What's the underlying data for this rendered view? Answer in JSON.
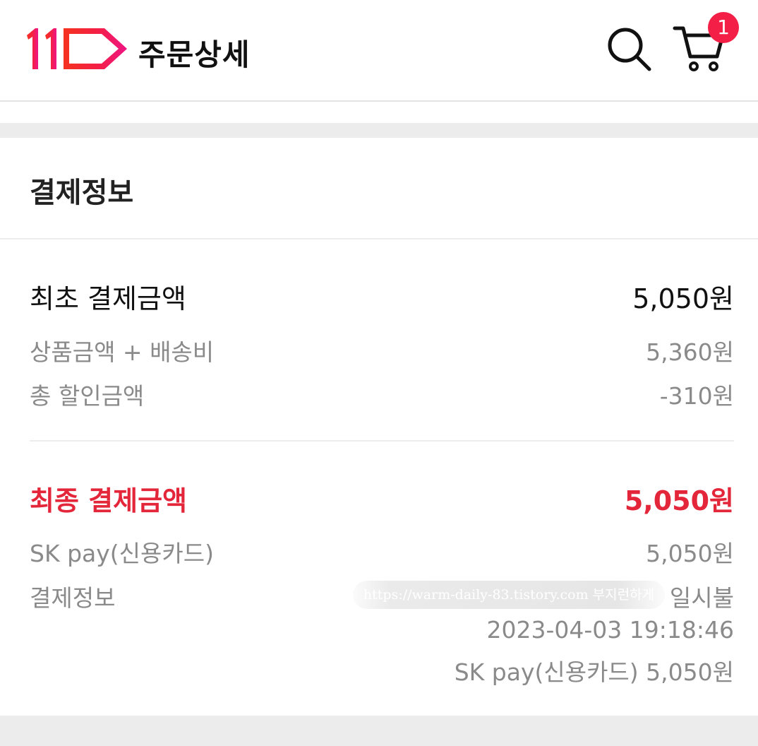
{
  "header": {
    "title": "주문상세",
    "logo": "11st-logo",
    "search_icon": "search-icon",
    "cart_icon": "cart-icon",
    "cart_count": "1",
    "brand_color": "#f41f47"
  },
  "payment": {
    "section_title": "결제정보",
    "initial": {
      "label": "최초 결제금액",
      "value": "5,050원"
    },
    "subtotal": {
      "label": "상품금액 + 배송비",
      "value": "5,360원"
    },
    "discount": {
      "label": "총 할인금액",
      "value": "-310원"
    },
    "final": {
      "label": "최종 결제금액",
      "value": "5,050원",
      "color": "#e4263b"
    },
    "method": {
      "label": "SK pay(신용카드)",
      "value": "5,050원"
    },
    "info": {
      "label": "결제정보",
      "watermark": "https://warm-daily-83.tistory.com 부지런하게",
      "installment": "일시불",
      "datetime": "2023-04-03 19:18:46",
      "summary": "SK pay(신용카드) 5,050원"
    }
  }
}
